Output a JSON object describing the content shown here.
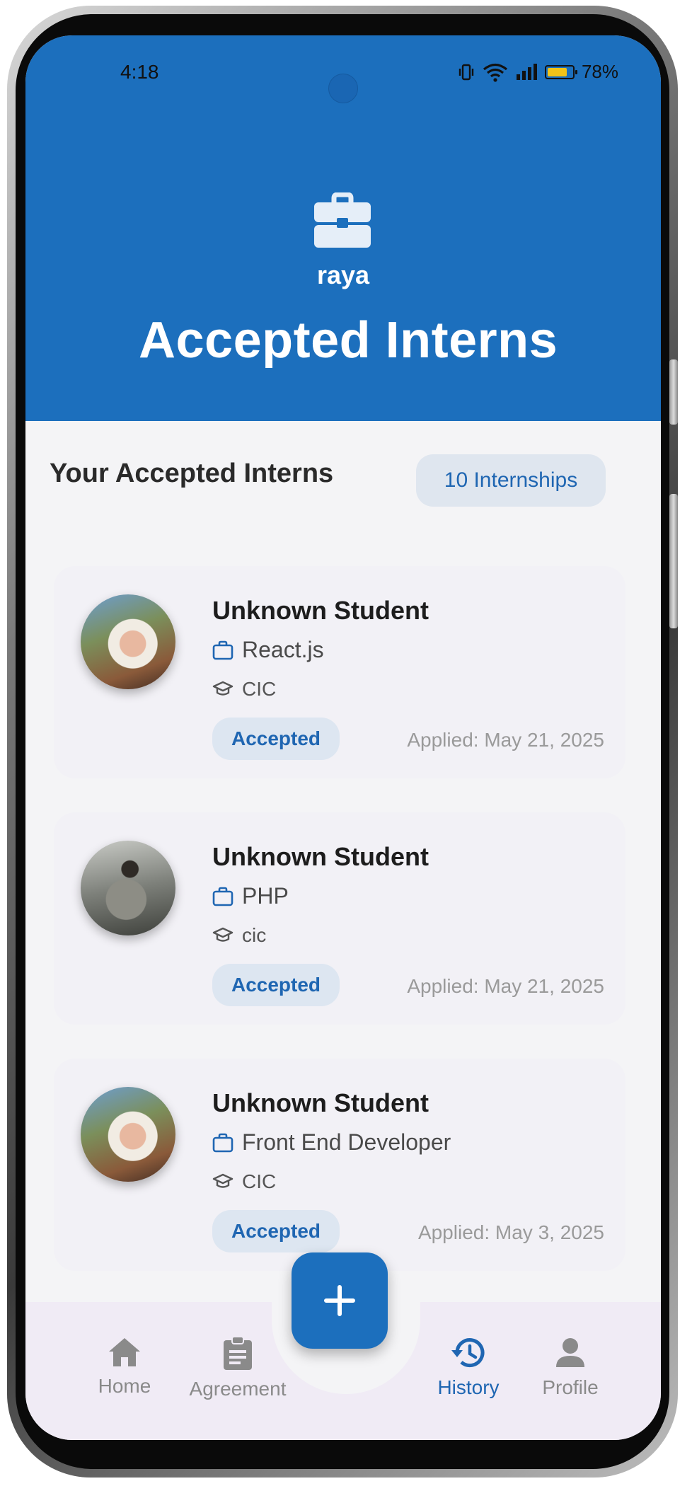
{
  "status_bar": {
    "time": "4:18",
    "battery_percent": "78%"
  },
  "header": {
    "org_name": "raya",
    "title": "Accepted Interns"
  },
  "section": {
    "title": "Your Accepted Interns",
    "count_label": "10 Internships"
  },
  "interns": [
    {
      "name": "Unknown Student",
      "position": "React.js",
      "school": "CIC",
      "status": "Accepted",
      "applied": "Applied: May 21, 2025"
    },
    {
      "name": "Unknown Student",
      "position": "PHP",
      "school": "cic",
      "status": "Accepted",
      "applied": "Applied: May 21, 2025"
    },
    {
      "name": "Unknown Student",
      "position": "Front End Developer",
      "school": "CIC",
      "status": "Accepted",
      "applied": "Applied: May 3, 2025"
    }
  ],
  "nav": {
    "home": "Home",
    "agreement": "Agreement",
    "history": "History",
    "profile": "Profile",
    "active": "History"
  },
  "colors": {
    "primary": "#1c6fbd",
    "background": "#f4f4f6",
    "pill": "#dde6f1"
  },
  "icons": [
    "briefcase-icon",
    "graduation-cap-icon",
    "plus-icon",
    "home-icon",
    "clipboard-icon",
    "history-icon",
    "person-icon"
  ]
}
